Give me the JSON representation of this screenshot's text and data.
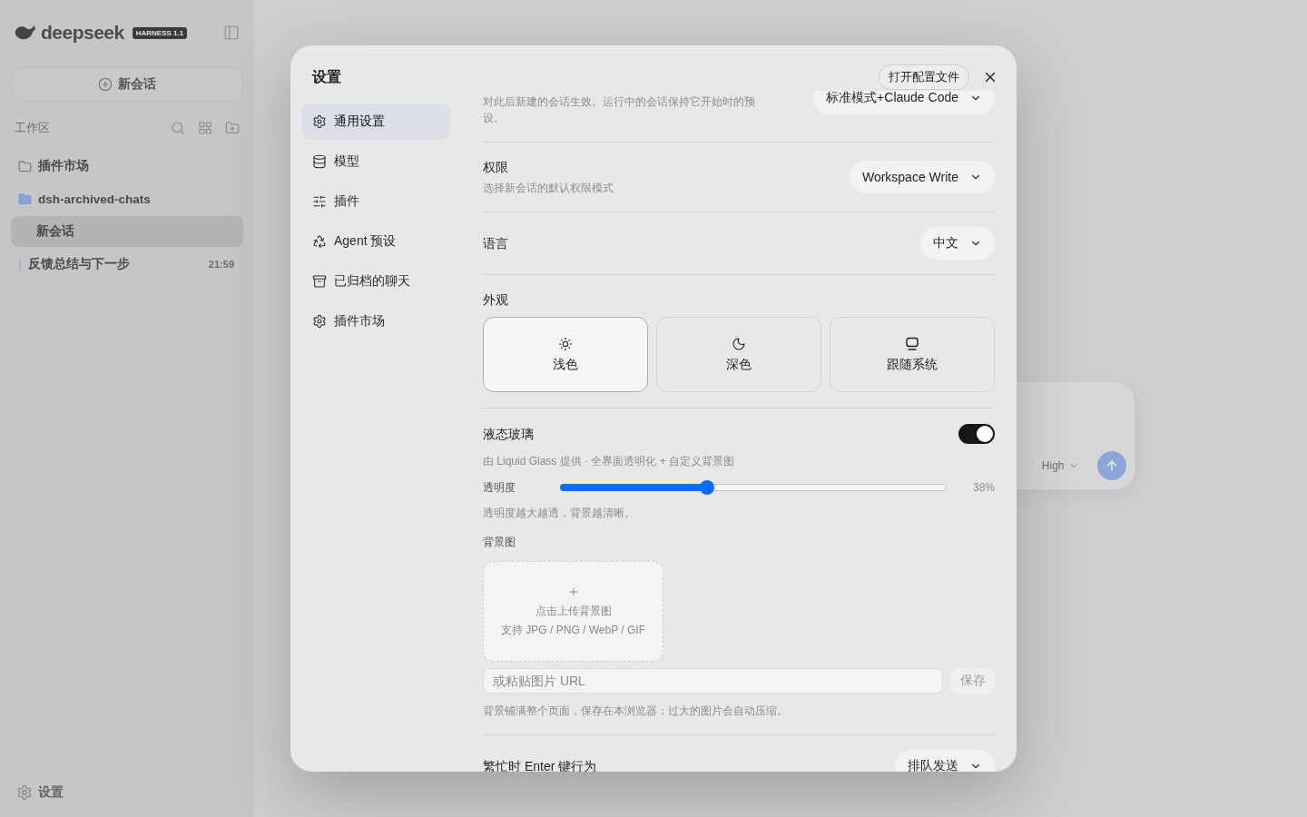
{
  "sidebar": {
    "brand": "deepseek",
    "badge": "HARNESS 1.1",
    "new_chat": "新会话",
    "section": "工作区",
    "items": [
      {
        "kind": "folder",
        "label": "插件市场",
        "selected": false
      },
      {
        "kind": "project",
        "label": "dsh-archived-chats",
        "selected": false
      },
      {
        "kind": "chat",
        "label": "新会话",
        "selected": true
      },
      {
        "kind": "thread",
        "label": "反馈总结与下一步",
        "time": "21:59",
        "selected": false
      }
    ],
    "settings": "设置"
  },
  "composer": {
    "effort": "High"
  },
  "settings": {
    "title": "设置",
    "open_config_button": "打开配置文件",
    "nav": [
      {
        "label": "通用设置",
        "selected": true
      },
      {
        "label": "模型",
        "selected": false
      },
      {
        "label": "插件",
        "selected": false
      },
      {
        "label": "Agent 预设",
        "selected": false
      },
      {
        "label": "已归档的聊天",
        "selected": false
      },
      {
        "label": "插件市场",
        "selected": false
      }
    ],
    "rows": [
      {
        "kind": "select",
        "description": "对此后新建的会话生效。运行中的会话保持它开始时的预设。",
        "value": "标准模式+Claude Code"
      },
      {
        "kind": "select",
        "label": "权限",
        "description": "选择新会话的默认权限模式",
        "value": "Workspace Write"
      },
      {
        "kind": "select",
        "label": "语言",
        "value": "中文"
      },
      {
        "kind": "appearance",
        "label": "外观",
        "options": [
          {
            "label": "浅色",
            "selected": true
          },
          {
            "label": "深色",
            "selected": false
          },
          {
            "label": "跟随系统",
            "selected": false
          }
        ]
      },
      {
        "kind": "glass",
        "label": "液态玻璃",
        "on": true,
        "description": "由 Liquid Glass 提供 · 全界面透明化 + 自定义背景图",
        "slider": {
          "label": "透明度",
          "level": 0.38,
          "reading": "38%"
        },
        "slider_hint": "透明度越大越透，背景越清晰。",
        "background": {
          "label": "背景图",
          "upload_title": "点击上传背景图",
          "upload_formats": "支持 JPG / PNG / WebP / GIF",
          "url_placeholder": "或粘贴图片 URL",
          "save_button": "保存",
          "hint": "背景铺满整个页面，保存在本浏览器；过大的图片会自动压缩。"
        }
      },
      {
        "kind": "select",
        "label": "繁忙时 Enter 键行为",
        "value": "排队发送"
      }
    ]
  }
}
